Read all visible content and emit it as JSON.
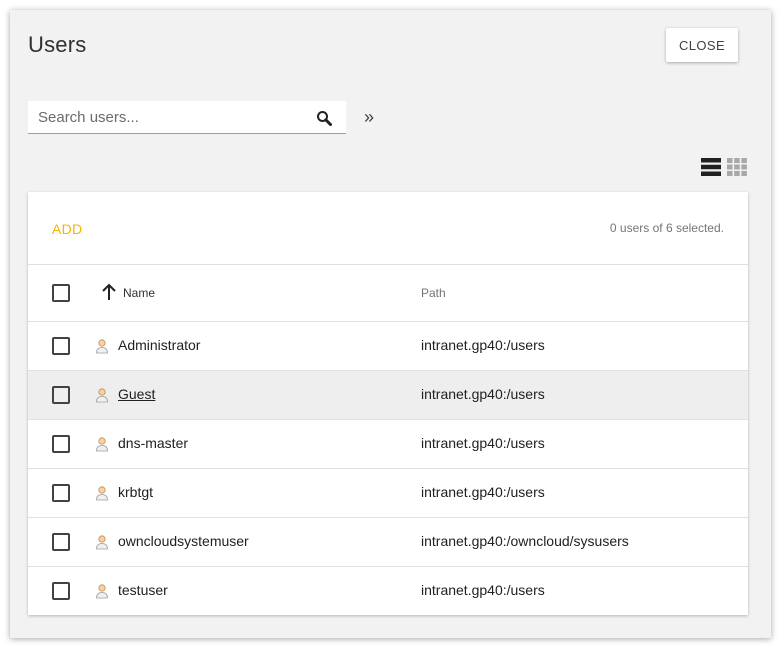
{
  "dialog": {
    "title": "Users",
    "close_label": "CLOSE"
  },
  "search": {
    "placeholder": "Search users...",
    "value": ""
  },
  "toolbar": {
    "expand_icon": "double-chevron-right-icon",
    "views": [
      "list-view-icon",
      "grid-view-icon"
    ]
  },
  "table": {
    "add_label": "ADD",
    "selection_text": "0 users of 6 selected.",
    "columns": {
      "name": "Name",
      "path": "Path"
    },
    "sort": {
      "column": "Name",
      "direction": "ascending"
    },
    "rows": [
      {
        "name": "Administrator",
        "path": "intranet.gp40:/users"
      },
      {
        "name": "Guest",
        "path": "intranet.gp40:/users"
      },
      {
        "name": "dns-master",
        "path": "intranet.gp40:/users"
      },
      {
        "name": "krbtgt",
        "path": "intranet.gp40:/users"
      },
      {
        "name": "owncloudsystemuser",
        "path": "intranet.gp40:/owncloud/sysusers"
      },
      {
        "name": "testuser",
        "path": "intranet.gp40:/users"
      }
    ]
  },
  "colors": {
    "accent": "#f4b400",
    "dialog_bg": "#f2f2f2",
    "row_hover": "#eeeeee"
  }
}
